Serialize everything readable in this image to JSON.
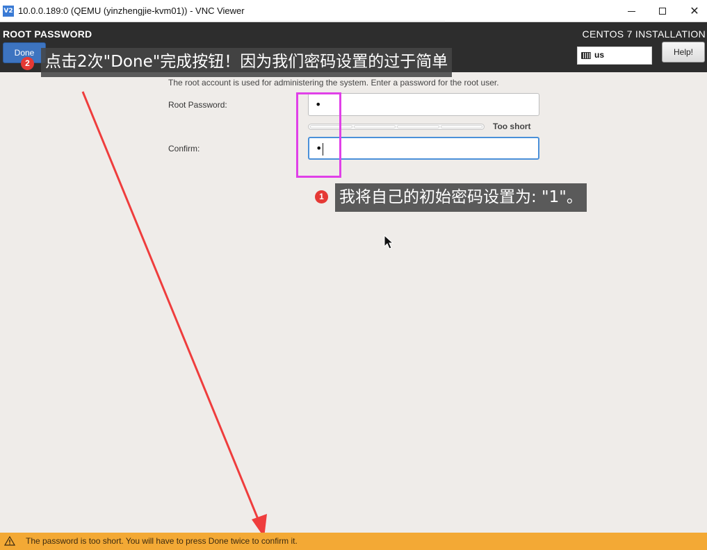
{
  "window": {
    "app_icon": "vnc-viewer-icon",
    "title": "10.0.0.189:0 (QEMU (yinzhengjie-kvm01)) - VNC Viewer",
    "controls": {
      "minimize": "minimize-icon",
      "maximize": "maximize-icon",
      "close": "✕"
    }
  },
  "header": {
    "spoke_title": "ROOT PASSWORD",
    "done_label": "Done",
    "product_title": "CENTOS 7 INSTALLATION",
    "keyboard_layout": "us",
    "help_label": "Help!",
    "colors": {
      "header_bg": "#2d2d2d",
      "done_bg": "#3d74c0"
    }
  },
  "annotations": {
    "top_badge": "2",
    "top_text": "点击2次\"Done\"完成按钮！因为我们密码设置的过于简单",
    "mid_badge": "1",
    "mid_text": "我将自己的初始密码设置为: \"1\"。",
    "colors": {
      "highlight": "#e040e8",
      "arrow": "#ef3d3d",
      "badge": "#e53935"
    }
  },
  "form": {
    "intro": "The root account is used for administering the system.  Enter a password for the root user.",
    "root_password_label": "Root Password:",
    "root_password_value": "•",
    "confirm_label": "Confirm:",
    "confirm_value": "•",
    "strength_label": "Too short",
    "strength_level": 0
  },
  "status": {
    "warning_icon": "warning-icon",
    "warning_text": "The password is too short. You will have to press Done twice to confirm it.",
    "color": "#f3a935"
  }
}
